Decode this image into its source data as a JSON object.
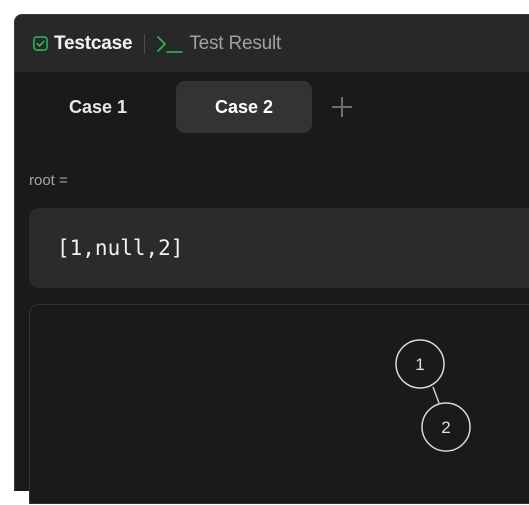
{
  "tabs": {
    "testcase_label": "Testcase",
    "result_label": "Test Result",
    "testcase_icon": "check-square-icon",
    "result_icon": "terminal-icon",
    "accent": "#2cbb5d"
  },
  "cases": {
    "items": [
      {
        "label": "Case 1",
        "active": false
      },
      {
        "label": "Case 2",
        "active": true
      }
    ],
    "add_icon": "plus-icon"
  },
  "param": {
    "name": "root =",
    "value": "[1,null,2]"
  },
  "tree": {
    "nodes": [
      {
        "label": "1"
      },
      {
        "label": "2"
      }
    ]
  }
}
